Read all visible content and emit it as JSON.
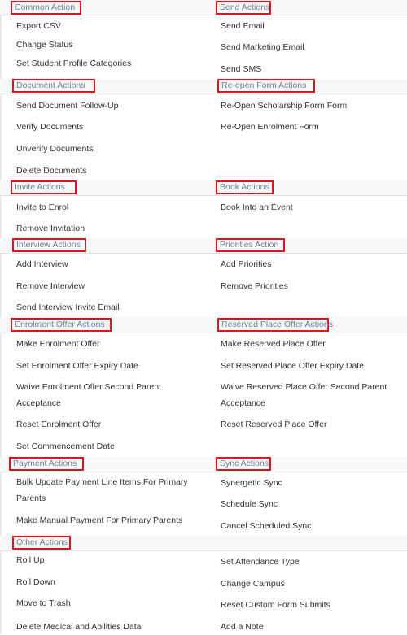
{
  "sections": {
    "common": {
      "title": "Common Action",
      "items": [
        "Export CSV",
        "Change Status",
        "Set Student Profile Categories"
      ]
    },
    "send": {
      "title": "Send Actions",
      "items": [
        "Send Email",
        "Send Marketing Email",
        "Send SMS"
      ]
    },
    "document": {
      "title": "Document Actions",
      "items": [
        "Send Document Follow-Up",
        "Verify Documents",
        "Unverify Documents",
        "Delete Documents"
      ]
    },
    "reopen": {
      "title": "Re-open Form Actions",
      "items": [
        "Re-Open Scholarship Form Form",
        "Re-Open Enrolment Form"
      ]
    },
    "invite": {
      "title": "Invite Actions",
      "items": [
        "Invite to Enrol",
        "Remove Invitation"
      ]
    },
    "book": {
      "title": "Book Actions",
      "items": [
        "Book Into an Event"
      ]
    },
    "interview": {
      "title": "Interview Actions",
      "items": [
        "Add Interview",
        "Remove Interview",
        "Send Interview Invite Email"
      ]
    },
    "priorities": {
      "title": "Priorities Action",
      "items": [
        "Add Priorities",
        "Remove Priorities"
      ]
    },
    "enrolment_offer": {
      "title": "Enrolment Offer Actions",
      "items": [
        "Make Enrolment Offer",
        "Set Enrolment Offer Expiry Date",
        "Waive Enrolment Offer Second Parent Acceptance",
        "Reset Enrolment Offer",
        "Set Commencement Date"
      ]
    },
    "reserved_place": {
      "title": "Reserved Place Offer Actions",
      "items": [
        "Make Reserved Place Offer",
        "Set Reserved Place Offer Expiry Date",
        "Waive Reserved Place Offer Second Parent Acceptance",
        "Reset Reserved Place Offer"
      ]
    },
    "payment": {
      "title": "Payment Actions",
      "items": [
        "Bulk Update Payment Line Items For Primary Parents",
        "Make Manual Payment For Primary Parents"
      ]
    },
    "sync": {
      "title": "Sync Actions",
      "items": [
        "Synergetic Sync",
        "Schedule Sync",
        "Cancel Scheduled Sync"
      ]
    },
    "other": {
      "title": "Other Actions",
      "items": [
        "Roll Up",
        "Roll Down",
        "Move to Trash",
        "Delete Medical and Abilities Data"
      ]
    },
    "other_right": {
      "items": [
        "Set Attendance Type",
        "Change Campus",
        "Reset Custom Form Submits",
        "Add a Note"
      ]
    }
  },
  "colors": {
    "highlight_border": "#e0141e",
    "header_text": "#6e7f90",
    "header_band": "#f7f8f9",
    "item_text": "#333333"
  }
}
